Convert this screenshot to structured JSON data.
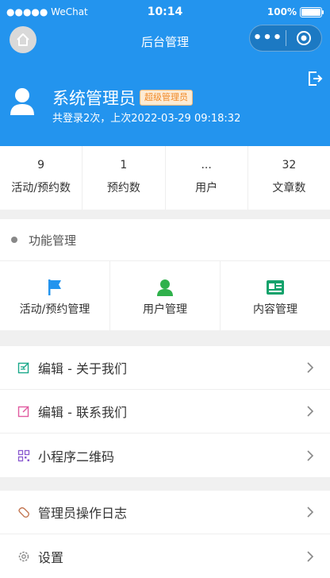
{
  "status_bar": {
    "carrier": "●●●●● WeChat",
    "time": "10:14",
    "battery": "100%"
  },
  "nav": {
    "title": "后台管理",
    "more": "•••"
  },
  "profile": {
    "name": "系统管理员",
    "role": "超级管理员",
    "login_info": "共登录2次，上次2022-03-29 09:18:32"
  },
  "stats": [
    {
      "value": "9",
      "label": "活动/预约数"
    },
    {
      "value": "1",
      "label": "预约数"
    },
    {
      "value": "...",
      "label": "用户"
    },
    {
      "value": "32",
      "label": "文章数"
    }
  ],
  "functions": {
    "title": "功能管理",
    "items": [
      {
        "label": "活动/预约管理",
        "icon": "flag-icon",
        "color": "#2394ee"
      },
      {
        "label": "用户管理",
        "icon": "user-icon",
        "color": "#2fb14b"
      },
      {
        "label": "内容管理",
        "icon": "content-card-icon",
        "color": "#13a26b"
      }
    ]
  },
  "menu1": [
    {
      "label": "编辑 - 关于我们",
      "icon": "edit-icon",
      "color": "#1aa88a"
    },
    {
      "label": "编辑 - 联系我们",
      "icon": "edit-icon",
      "color": "#e05aa0"
    },
    {
      "label": "小程序二维码",
      "icon": "qrcode-icon",
      "color": "#8a5ad0"
    }
  ],
  "menu2": [
    {
      "label": "管理员操作日志",
      "icon": "log-icon",
      "color": "#c0704a"
    },
    {
      "label": "设置",
      "icon": "gear-icon",
      "color": "#888888"
    }
  ],
  "colors": {
    "primary": "#2394ee",
    "badge_text": "#f08a29"
  }
}
